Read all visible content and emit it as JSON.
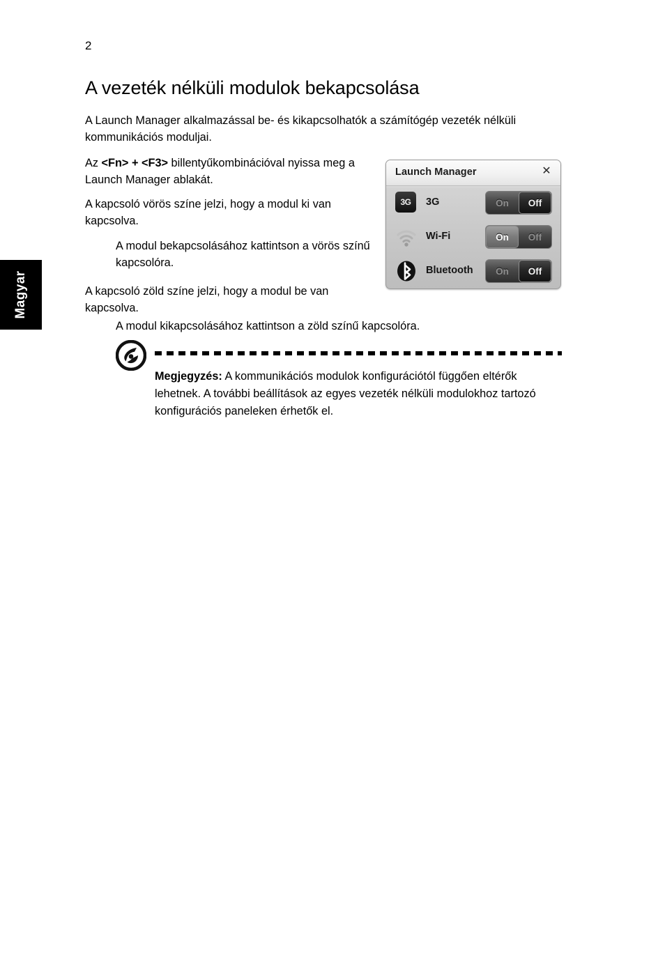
{
  "page": {
    "number": "2",
    "language_tab": "Magyar"
  },
  "document": {
    "title": "A vezeték nélküli modulok bekapcsolása",
    "paragraphs": [
      "A Launch Manager alkalmazással be- és kikapcsolhatók a számítógép vezeték nélküli kommunikációs moduljai.",
      "A kapcsoló vörös színe jelzi, hogy a modul ki van kapcsolva.",
      "A modul bekapcsolásához kattintson a vörös színű kapcsolóra.",
      "A kapcsoló zöld színe jelzi, hogy a modul be van kapcsolva.",
      "A modul kikapcsolásához kattintson a zöld színű kapcsolóra."
    ],
    "shortcut_sentence": {
      "prefix": "Az ",
      "keys": "<Fn> + <F3>",
      "suffix": " billentyűkombinációval nyissa meg a Launch Manager ablakát."
    }
  },
  "note": {
    "icon": "acer-logo-icon",
    "label": "Megjegyzés:",
    "text": " A kommunikációs modulok konfigurációtól függően eltérők lehetnek. A további beállítások az egyes vezeték nélküli modulokhoz tartozó konfigurációs paneleken érhetők el."
  },
  "launch_manager": {
    "title": "Launch Manager",
    "close_label": "✕",
    "rows": [
      {
        "icon": "cellular-3g-icon",
        "icon_text": "3G",
        "label": "3G",
        "on_label": "On",
        "off_label": "Off",
        "state": "off"
      },
      {
        "icon": "wifi-icon",
        "icon_text": "",
        "label": "Wi-Fi",
        "on_label": "On",
        "off_label": "Off",
        "state": "on"
      },
      {
        "icon": "bluetooth-icon",
        "icon_text": "",
        "label": "Bluetooth",
        "on_label": "On",
        "off_label": "Off",
        "state": "off"
      }
    ]
  },
  "colors": {
    "page_background": "#ffffff",
    "text": "#000000",
    "tab_background": "#000000",
    "tab_text": "#ffffff",
    "panel_background": "#c9c9c9",
    "toggle_track": "#3a3a3a"
  }
}
